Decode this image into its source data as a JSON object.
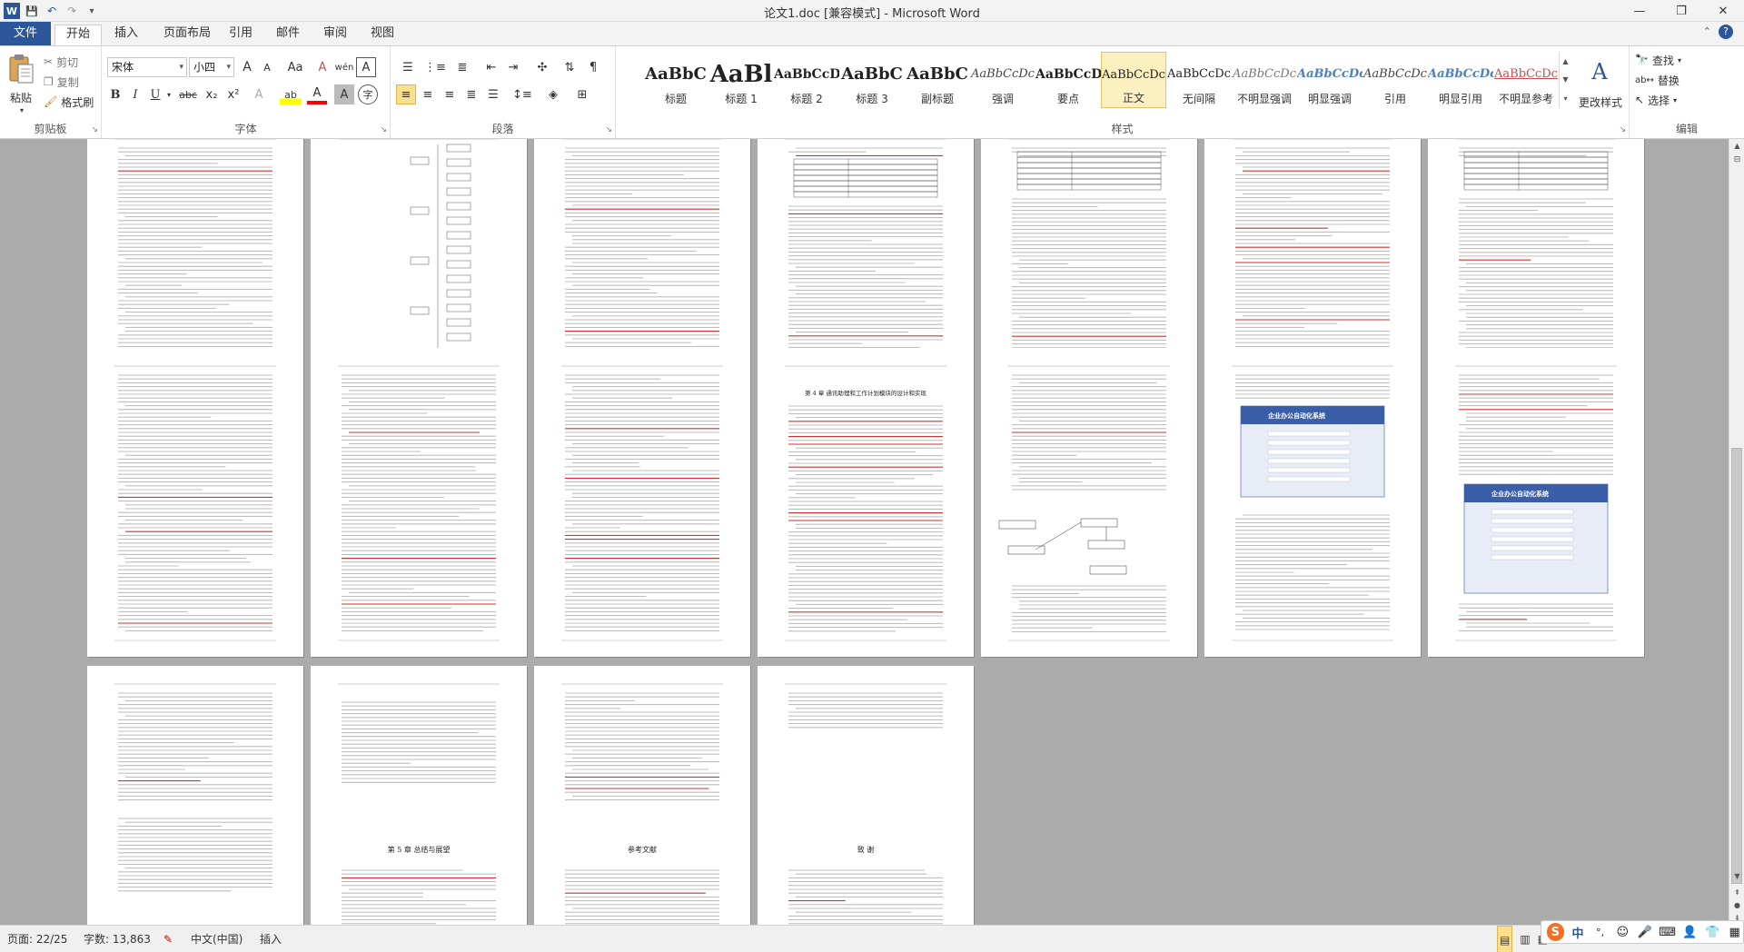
{
  "window": {
    "title": "论文1.doc [兼容模式] - Microsoft Word",
    "minimize_glyph": "—",
    "restore_glyph": "❐",
    "close_glyph": "✕",
    "help_glyph": "?"
  },
  "qat": {
    "save_glyph": "💾",
    "undo_glyph": "↶",
    "redo_glyph": "↷",
    "more_glyph": "▾"
  },
  "tabs": {
    "file": "文件",
    "home": "开始",
    "insert": "插入",
    "page_layout": "页面布局",
    "references": "引用",
    "mailings": "邮件",
    "review": "审阅",
    "view": "视图"
  },
  "clipboard": {
    "label": "剪贴板",
    "paste": "粘贴",
    "cut": "剪切",
    "copy": "复制",
    "format_painter": "格式刷"
  },
  "font": {
    "label": "字体",
    "font_name": "宋体",
    "font_size": "小四",
    "grow": "A",
    "shrink": "A",
    "change_case": "Aa",
    "clear_format": "A",
    "phonetic": "wén",
    "char_border": "A",
    "bold": "B",
    "italic": "I",
    "underline": "U",
    "strike": "abc",
    "subscript": "x₂",
    "superscript": "x²",
    "effects": "A",
    "highlight": "ab",
    "font_color": "A",
    "char_shading": "A",
    "enclose": "字"
  },
  "paragraph": {
    "label": "段落"
  },
  "styles": {
    "label": "样式",
    "items": [
      {
        "sample": "AaBbC",
        "name": "标题"
      },
      {
        "sample": "AaBl",
        "name": "标题 1"
      },
      {
        "sample": "AaBbCcD",
        "name": "标题 2"
      },
      {
        "sample": "AaBbC",
        "name": "标题 3"
      },
      {
        "sample": "AaBbC",
        "name": "副标题"
      },
      {
        "sample": "AaBbCcDc",
        "name": "强调"
      },
      {
        "sample": "AaBbCcD",
        "name": "要点"
      },
      {
        "sample": "AaBbCcDc",
        "name": "正文"
      },
      {
        "sample": "AaBbCcDc",
        "name": "无间隔"
      },
      {
        "sample": "AaBbCcDc",
        "name": "不明显强调"
      },
      {
        "sample": "AaBbCcDc",
        "name": "明显强调"
      },
      {
        "sample": "AaBbCcDc",
        "name": "引用"
      },
      {
        "sample": "AaBbCcDc",
        "name": "明显引用"
      },
      {
        "sample": "AaBbCcDc",
        "name": "不明显参考"
      }
    ],
    "change_styles": "更改样式"
  },
  "editing": {
    "label": "编辑",
    "find": "查找",
    "replace": "替换",
    "select": "选择"
  },
  "pages": {
    "chapter4_title": "第 4 章  通讯助理和工作计划模块的设计和实现",
    "chapter5_title": "第 5 章  总结与展望",
    "references_title": "参考文献",
    "thanks_title": "致  谢",
    "screenshot_banner": "企业办公自动化系统"
  },
  "status": {
    "page": "页面: 22/25",
    "words": "字数: 13,863",
    "language": "中文(中国)",
    "mode": "插入",
    "zoom_percent": "",
    "ime_chinese": "中",
    "ime_punct": "°,"
  },
  "colors": {
    "file_tab": "#2b579a",
    "doc_bg": "#ababab",
    "selected_style": "#fcf0c0",
    "red_text": "#c00000",
    "blue_text": "#2b579a"
  }
}
